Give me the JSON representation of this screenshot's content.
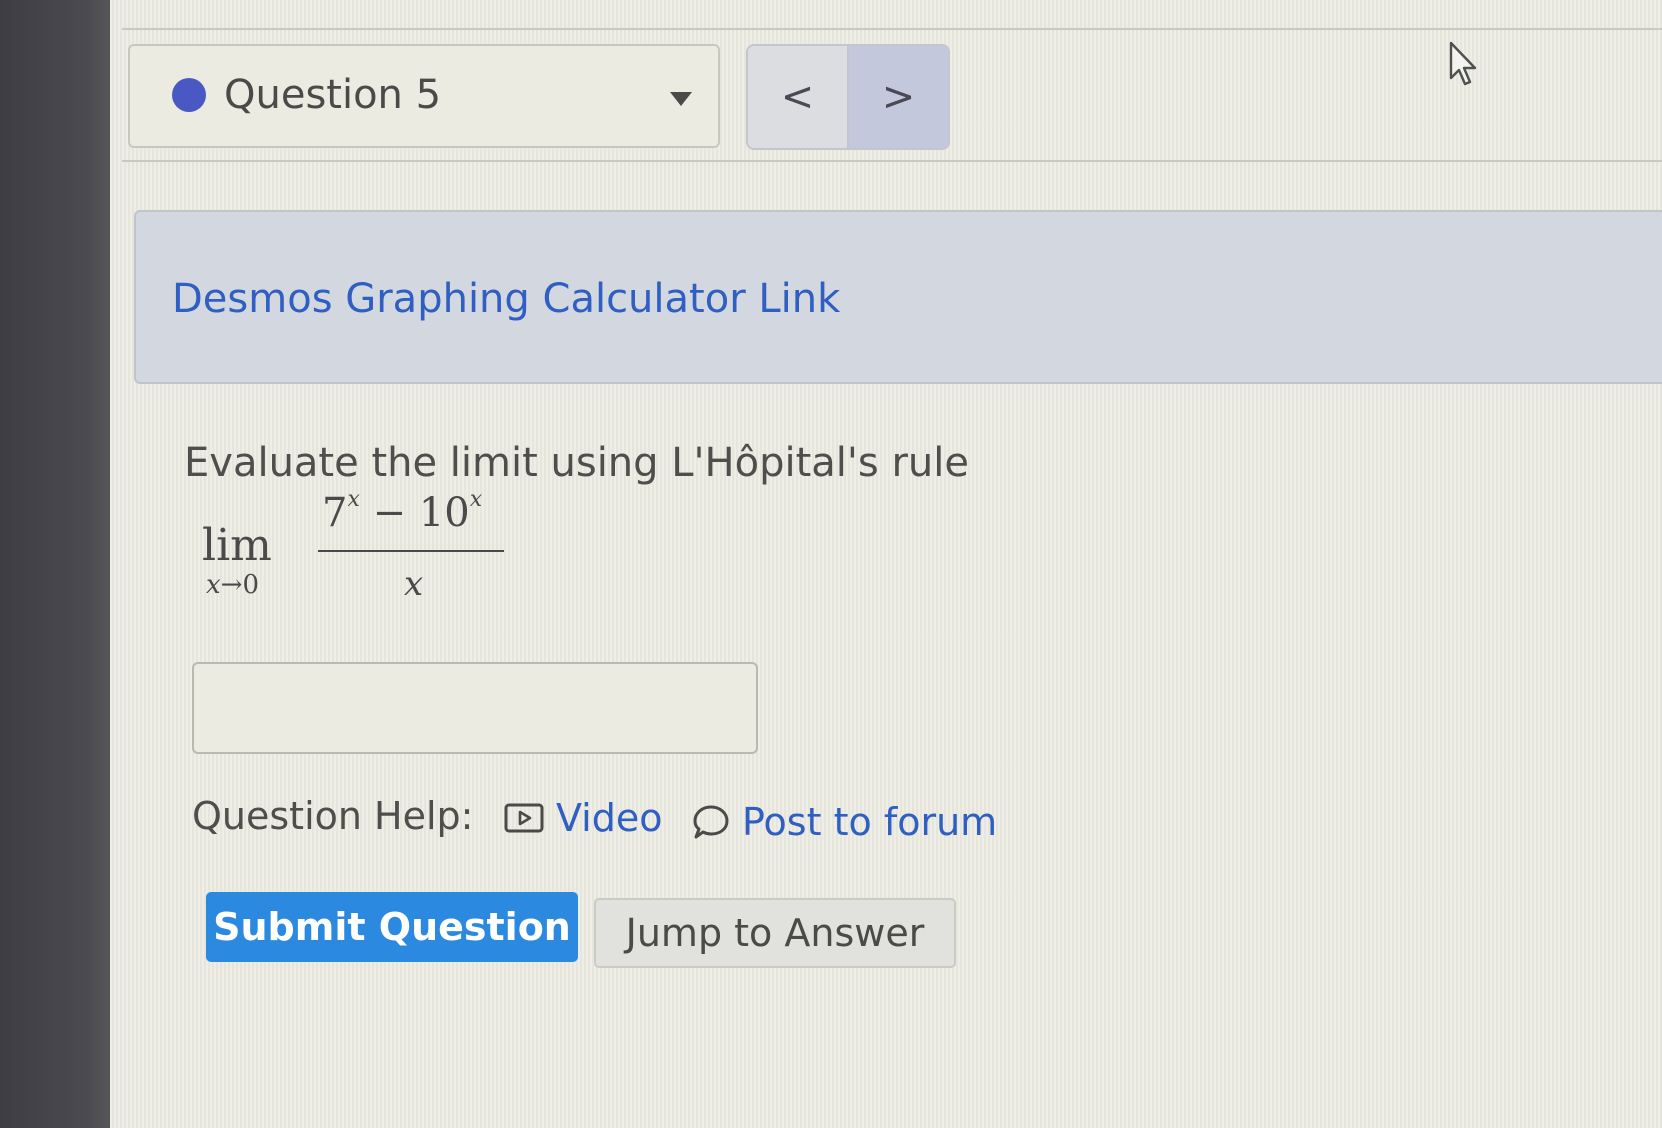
{
  "question_nav": {
    "selected_question": "Question 5",
    "prev_symbol": "<",
    "next_symbol": ">"
  },
  "info": {
    "desmos_link_label": "Desmos Graphing Calculator Link"
  },
  "question": {
    "prompt": "Evaluate the limit using L'Hôpital's rule",
    "math": {
      "lim": "lim",
      "var": "x",
      "arrow": "→",
      "target": "0",
      "num_base_1": "7",
      "num_exp_1": "x",
      "minus": "−",
      "num_base_2": "10",
      "num_exp_2": "x",
      "denominator": "x"
    },
    "answer_value": ""
  },
  "help": {
    "label": "Question Help:",
    "video_label": "Video",
    "forum_label": "Post to forum"
  },
  "actions": {
    "submit_label": "Submit Question",
    "jump_label": "Jump to Answer"
  },
  "colors": {
    "link": "#2f5fc2",
    "submit_bg": "#2b8ae0",
    "status_dot": "#4a58c4"
  }
}
